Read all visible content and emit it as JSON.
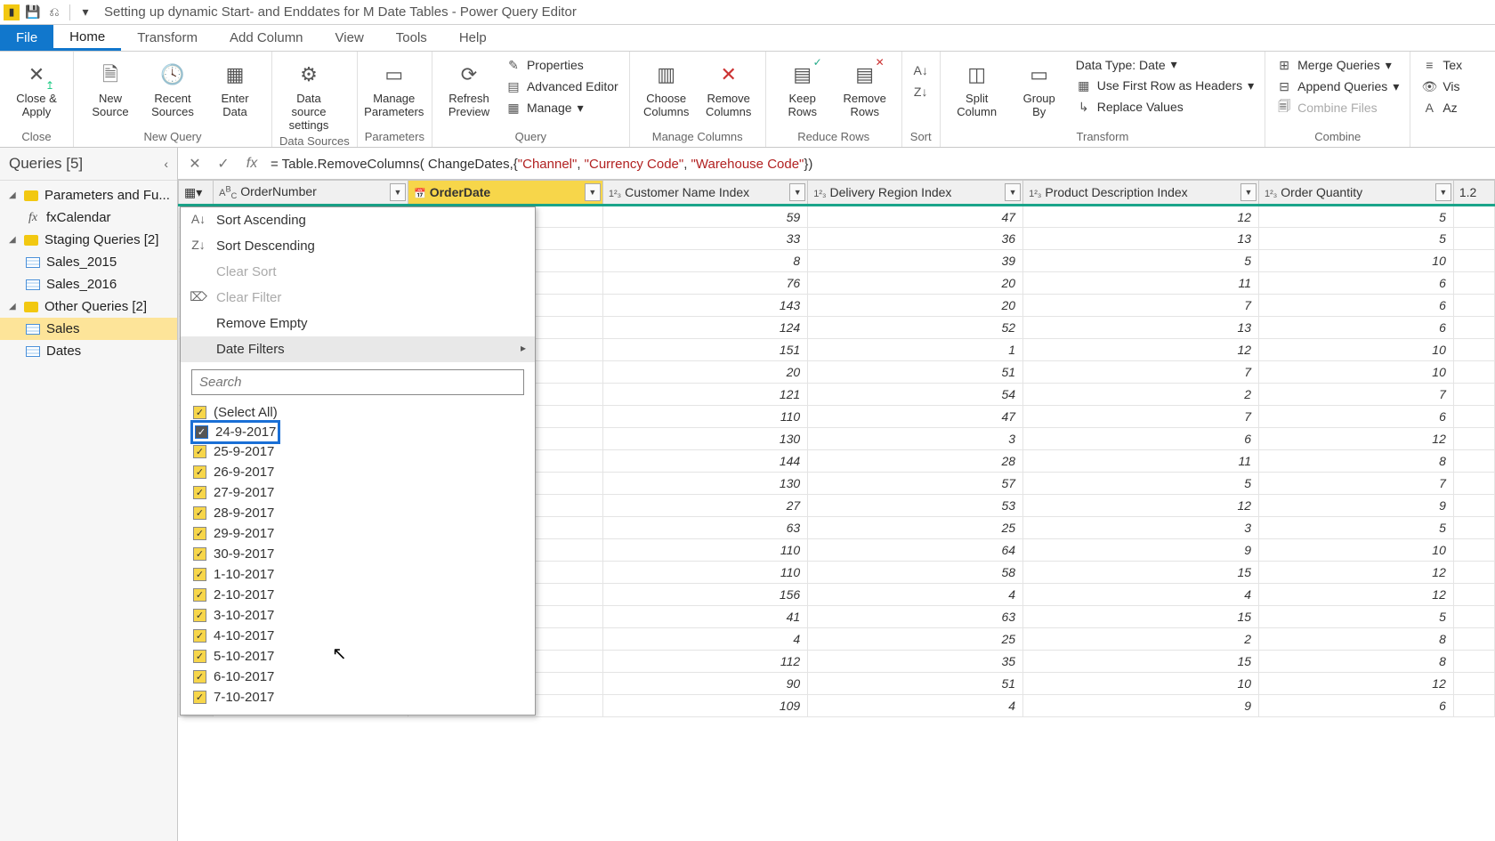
{
  "titlebar": {
    "title": "Setting up dynamic Start- and Enddates for M Date Tables - Power Query Editor"
  },
  "tabs": {
    "file": "File",
    "home": "Home",
    "transform": "Transform",
    "addcolumn": "Add Column",
    "view": "View",
    "tools": "Tools",
    "help": "Help"
  },
  "ribbon": {
    "close_apply": "Close &\nApply",
    "close_group": "Close",
    "new_source": "New\nSource",
    "recent_sources": "Recent\nSources",
    "enter_data": "Enter\nData",
    "newquery_group": "New Query",
    "data_source_settings": "Data source\nsettings",
    "datasources_group": "Data Sources",
    "manage_parameters": "Manage\nParameters",
    "parameters_group": "Parameters",
    "refresh_preview": "Refresh\nPreview",
    "properties": "Properties",
    "advanced_editor": "Advanced Editor",
    "manage": "Manage",
    "query_group": "Query",
    "choose_columns": "Choose\nColumns",
    "remove_columns": "Remove\nColumns",
    "managecolumns_group": "Manage Columns",
    "keep_rows": "Keep\nRows",
    "remove_rows": "Remove\nRows",
    "reducerows_group": "Reduce Rows",
    "sort_group": "Sort",
    "split_column": "Split\nColumn",
    "group_by": "Group\nBy",
    "data_type": "Data Type: Date",
    "first_row_headers": "Use First Row as Headers",
    "replace_values": "Replace Values",
    "transform_group": "Transform",
    "merge_queries": "Merge Queries",
    "append_queries": "Append Queries",
    "combine_files": "Combine Files",
    "combine_group": "Combine",
    "text_analytics": "Tex",
    "vision": "Vis",
    "azure_ml": "Az"
  },
  "queries": {
    "header": "Queries [5]",
    "groups": {
      "params": "Parameters and Fu...",
      "fxcal": "fxCalendar",
      "staging": "Staging Queries [2]",
      "s2015": "Sales_2015",
      "s2016": "Sales_2016",
      "other": "Other Queries [2]",
      "sales": "Sales",
      "dates": "Dates"
    }
  },
  "formula": {
    "prefix": "= Table.RemoveColumns( ChangeDates,{",
    "s1": "\"Channel\"",
    "c1": ", ",
    "s2": "\"Currency Code\"",
    "c2": ", ",
    "s3": "\"Warehouse Code\"",
    "suffix": "})"
  },
  "columns": {
    "order_number": "OrderNumber",
    "order_date": "OrderDate",
    "customer": "Customer Name Index",
    "delivery": "Delivery Region Index",
    "product": "Product Description Index",
    "qty": "Order Quantity",
    "extra": "1.2"
  },
  "filter_menu": {
    "sort_asc": "Sort Ascending",
    "sort_desc": "Sort Descending",
    "clear_sort": "Clear Sort",
    "clear_filter": "Clear Filter",
    "remove_empty": "Remove Empty",
    "date_filters": "Date Filters",
    "search_placeholder": "Search",
    "select_all": "(Select All)",
    "dates": [
      "24-9-2017",
      "25-9-2017",
      "26-9-2017",
      "27-9-2017",
      "28-9-2017",
      "29-9-2017",
      "30-9-2017",
      "1-10-2017",
      "2-10-2017",
      "3-10-2017",
      "4-10-2017",
      "5-10-2017",
      "6-10-2017",
      "7-10-2017"
    ]
  },
  "rows": [
    {
      "c": 59,
      "d": 47,
      "p": 12,
      "q": 5
    },
    {
      "c": 33,
      "d": 36,
      "p": 13,
      "q": 5
    },
    {
      "c": 8,
      "d": 39,
      "p": 5,
      "q": 10
    },
    {
      "c": 76,
      "d": 20,
      "p": 11,
      "q": 6
    },
    {
      "c": 143,
      "d": 20,
      "p": 7,
      "q": 6
    },
    {
      "c": 124,
      "d": 52,
      "p": 13,
      "q": 6
    },
    {
      "c": 151,
      "d": 1,
      "p": 12,
      "q": 10
    },
    {
      "c": 20,
      "d": 51,
      "p": 7,
      "q": 10
    },
    {
      "c": 121,
      "d": 54,
      "p": 2,
      "q": 7
    },
    {
      "c": 110,
      "d": 47,
      "p": 7,
      "q": 6
    },
    {
      "c": 130,
      "d": 3,
      "p": 6,
      "q": 12
    },
    {
      "c": 144,
      "d": 28,
      "p": 11,
      "q": 8
    },
    {
      "c": 130,
      "d": 57,
      "p": 5,
      "q": 7
    },
    {
      "c": 27,
      "d": 53,
      "p": 12,
      "q": 9
    },
    {
      "c": 63,
      "d": 25,
      "p": 3,
      "q": 5
    },
    {
      "c": 110,
      "d": 64,
      "p": 9,
      "q": 10
    },
    {
      "c": 110,
      "d": 58,
      "p": 15,
      "q": 12
    },
    {
      "c": 156,
      "d": 4,
      "p": 4,
      "q": 12
    },
    {
      "c": 41,
      "d": 63,
      "p": 15,
      "q": 5
    },
    {
      "c": 4,
      "d": 25,
      "p": 2,
      "q": 8
    },
    {
      "c": 112,
      "d": 35,
      "p": 15,
      "q": 8
    },
    {
      "c": 90,
      "d": 51,
      "p": 10,
      "q": 12
    },
    {
      "c": 109,
      "d": 4,
      "p": 9,
      "q": 6
    }
  ]
}
